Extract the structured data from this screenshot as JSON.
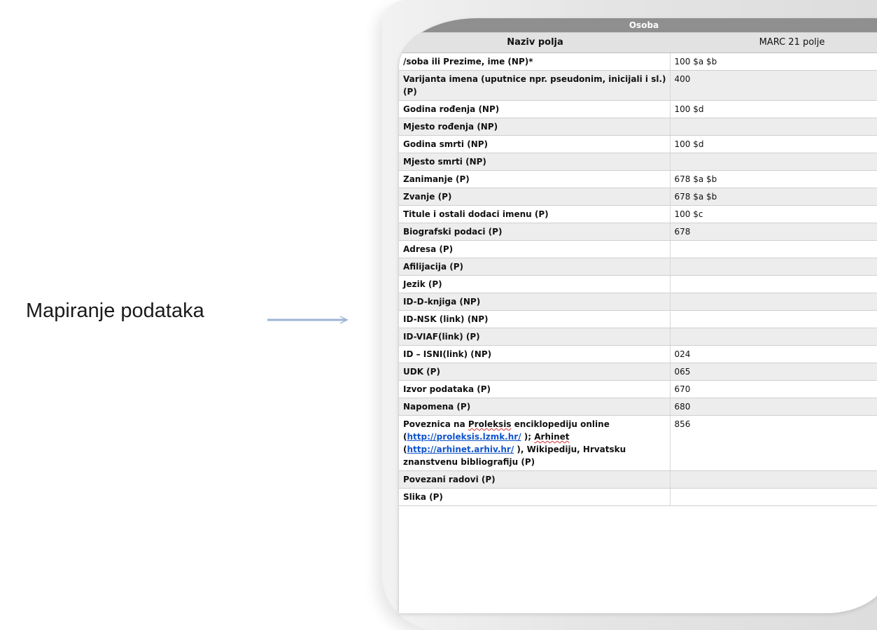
{
  "slide": {
    "label": "Mapiranje podataka"
  },
  "table": {
    "title": "Osoba",
    "col1_header": "Naziv polja",
    "col2_header": "MARC 21 polje",
    "rows": [
      {
        "field": "/soba ili Prezime, ime  (NP)*",
        "marc": "100 $a $b"
      },
      {
        "field": "Varijanta imena (uputnice npr. pseudonim, inicijali i sl.) (P)",
        "marc": "400"
      },
      {
        "field": "Godina  rođenja (NP)",
        "marc": "100 $d"
      },
      {
        "field": "Mjesto rođenja (NP)",
        "marc": ""
      },
      {
        "field": "Godina smrti (NP)",
        "marc": "100 $d"
      },
      {
        "field": "Mjesto smrti (NP)",
        "marc": ""
      },
      {
        "field": "Zanimanje (P)",
        "marc": "678 $a $b"
      },
      {
        "field": "Zvanje (P)",
        "marc": "678 $a $b"
      },
      {
        "field": "Titule i ostali dodaci imenu (P)",
        "marc": "100 $c"
      },
      {
        "field": "Biografski podaci (P)",
        "marc": "678"
      },
      {
        "field": "Adresa (P)",
        "marc": ""
      },
      {
        "field": "Afilijacija (P)",
        "marc": ""
      },
      {
        "field": "Jezik (P)",
        "marc": ""
      },
      {
        "field": "ID-D-knjiga (NP)",
        "marc": ""
      },
      {
        "field": "ID-NSK (link) (NP)",
        "marc": ""
      },
      {
        "field": "ID-VIAF(link) (P)",
        "marc": ""
      },
      {
        "field": "ID – ISNI(link) (NP)",
        "marc": "024"
      },
      {
        "field": "UDK (P)",
        "marc": "065"
      },
      {
        "field": "Izvor podataka (P)",
        "marc": "670"
      },
      {
        "field": "Napomena (P)",
        "marc": "680"
      }
    ],
    "link_row": {
      "t1": "Poveznica na ",
      "t2": "Proleksis",
      "t3": " enciklopediju online (",
      "link1": "http://proleksis.lzmk.hr/",
      "t4": " ); ",
      "t5": "Arhinet",
      "t6": " (",
      "link2": "http://arhinet.arhiv.hr/",
      "t7": " ), Wikipediju, Hrvatsku znanstvenu bibliografiju (P)",
      "marc": "856"
    },
    "tail_rows": [
      {
        "field": "Povezani radovi (P)",
        "marc": ""
      },
      {
        "field": "Slika (P)",
        "marc": ""
      }
    ]
  }
}
